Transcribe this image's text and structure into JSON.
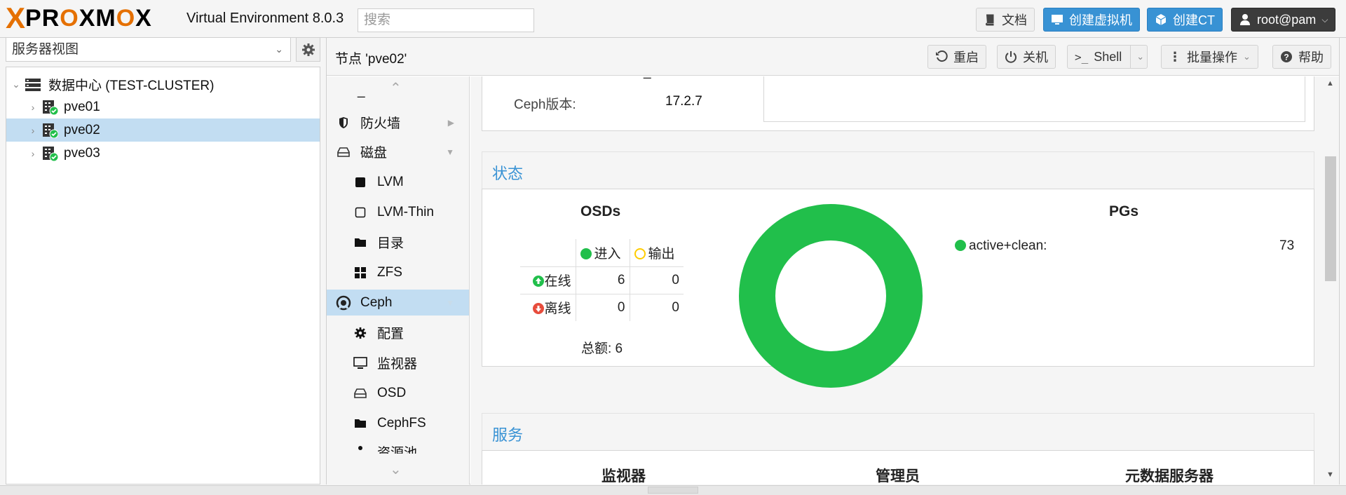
{
  "header": {
    "logo_x": "X",
    "logo_word_1": "PR",
    "logo_o1": "O",
    "logo_word_2": "XM",
    "logo_o2": "O",
    "logo_word_3": "X",
    "version": "Virtual Environment 8.0.3",
    "search_placeholder": "搜索",
    "docs_label": "文档",
    "create_vm_label": "创建虚拟机",
    "create_ct_label": "创建CT",
    "user_label": "root@pam"
  },
  "tree": {
    "view_selected": "服务器视图",
    "root_label": "数据中心 (TEST-CLUSTER)",
    "nodes": [
      "pve01",
      "pve02",
      "pve03"
    ],
    "selected_node": "pve02"
  },
  "content": {
    "title": "节点 'pve02'",
    "buttons": {
      "restart": "重启",
      "shutdown": "关机",
      "shell": "Shell",
      "bulk": "批量操作",
      "help": "帮助"
    }
  },
  "menu": {
    "partial_top": "_",
    "firewall": "防火墙",
    "disks": "磁盘",
    "lvm": "LVM",
    "lvm_thin": "LVM-Thin",
    "directory": "目录",
    "zfs": "ZFS",
    "ceph": "Ceph",
    "config": "配置",
    "monitor": "监视器",
    "osd": "OSD",
    "cephfs": "CephFS",
    "pools_partial": "资源池"
  },
  "main": {
    "partial_underscore": "_",
    "ceph_version_label": "Ceph版本:",
    "ceph_version_value": "17.2.7",
    "status": {
      "title": "状态",
      "osds_title": "OSDs",
      "col_in": "进入",
      "col_out": "输出",
      "row_up": "在线",
      "row_down": "离线",
      "up_in": "6",
      "up_out": "0",
      "down_in": "0",
      "down_out": "0",
      "total": "总额: 6",
      "pgs_title": "PGs",
      "pg_state": "active+clean:",
      "pg_count": "73",
      "colors": {
        "green": "#21bf4b",
        "orange": "#ffcc00",
        "red": "#e74c3c"
      }
    },
    "services": {
      "title": "服务",
      "col1": "监视器",
      "col2": "管理员",
      "col3": "元数据服务器"
    }
  }
}
